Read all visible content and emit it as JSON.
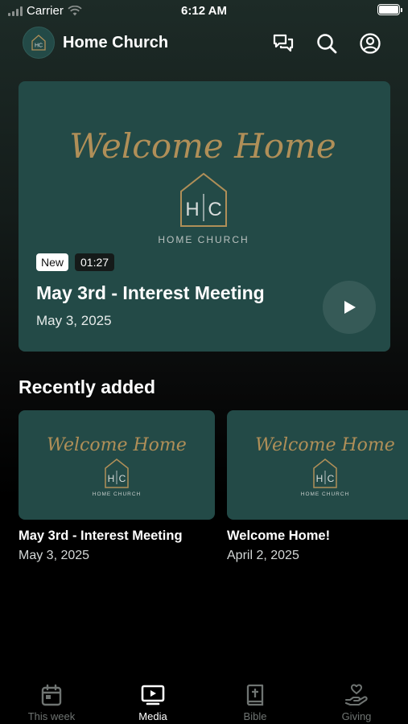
{
  "status_bar": {
    "carrier": "Carrier",
    "time": "6:12 AM"
  },
  "header": {
    "logo_text": "HC",
    "title": "Home Church",
    "icons": [
      "chat-icon",
      "search-icon",
      "profile-icon"
    ]
  },
  "featured": {
    "art_script": "Welcome Home",
    "art_monogram_left": "H",
    "art_monogram_right": "C",
    "art_subtitle": "HOME CHURCH",
    "badge": "New",
    "duration": "01:27",
    "title": "May 3rd - Interest Meeting",
    "date": "May 3, 2025"
  },
  "recently_added": {
    "heading": "Recently added",
    "items": [
      {
        "art_script": "Welcome Home",
        "art_monogram_left": "H",
        "art_monogram_right": "C",
        "art_subtitle": "HOME CHURCH",
        "title": "May 3rd - Interest Meeting",
        "date": "May 3, 2025"
      },
      {
        "art_script": "Welcome Home",
        "art_monogram_left": "H",
        "art_monogram_right": "C",
        "art_subtitle": "HOME CHURCH",
        "title": "Welcome Home!",
        "date": "April 2, 2025"
      }
    ]
  },
  "tab_bar": {
    "tabs": [
      {
        "label": "This week",
        "icon": "calendar-icon",
        "active": false
      },
      {
        "label": "Media",
        "icon": "tv-play-icon",
        "active": true
      },
      {
        "label": "Bible",
        "icon": "bible-icon",
        "active": false
      },
      {
        "label": "Giving",
        "icon": "giving-hand-icon",
        "active": false
      }
    ]
  },
  "colors": {
    "card_teal": "#234a47",
    "gold": "#b08f58",
    "inactive_tab": "#6f7472"
  }
}
